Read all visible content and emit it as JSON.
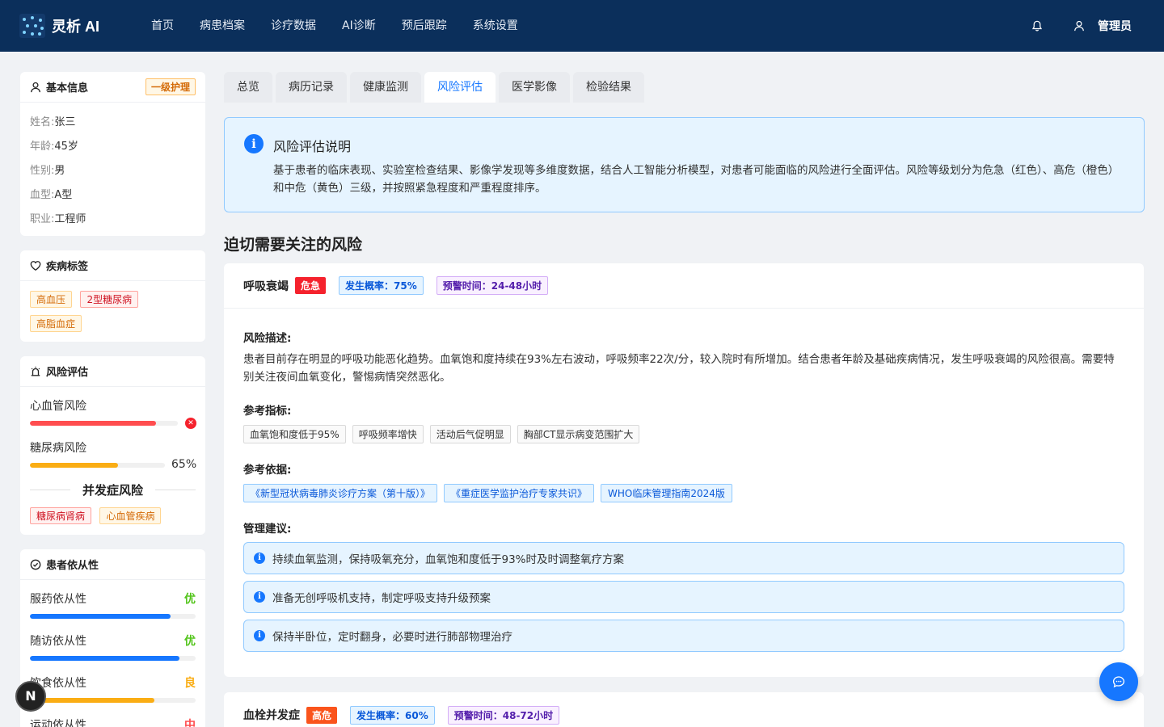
{
  "app": {
    "name": "灵析 AI"
  },
  "nav": [
    "首页",
    "病患档案",
    "诊疗数据",
    "AI诊断",
    "预后跟踪",
    "系统设置"
  ],
  "user": {
    "name": "管理员"
  },
  "basic": {
    "title": "基本信息",
    "badge": "一级护理",
    "rows": [
      {
        "k": "姓名:",
        "v": "张三"
      },
      {
        "k": "年龄:",
        "v": "45岁"
      },
      {
        "k": "性别:",
        "v": "男"
      },
      {
        "k": "血型:",
        "v": "A型"
      },
      {
        "k": "职业:",
        "v": "工程师"
      }
    ]
  },
  "disease": {
    "title": "疾病标签",
    "tags": [
      "高血压",
      "2型糖尿病",
      "高脂血症"
    ]
  },
  "risk_panel": {
    "title": "风险评估",
    "items": [
      {
        "label": "心血管风险",
        "percent": 85,
        "color": "#ff4d4f"
      },
      {
        "label": "糖尿病风险",
        "percent": 65,
        "pct_text": "65%",
        "color": "#faad14"
      }
    ],
    "complication_title": "并发症风险",
    "complications": [
      "糖尿病肾病",
      "心血管疾病"
    ]
  },
  "compliance": {
    "title": "患者依从性",
    "items": [
      {
        "label": "服药依从性",
        "grade": "优",
        "percent": 85,
        "color": "#1677ff",
        "grade_color": "#52c41a"
      },
      {
        "label": "随访依从性",
        "grade": "优",
        "percent": 90,
        "color": "#1677ff",
        "grade_color": "#52c41a"
      },
      {
        "label": "饮食依从性",
        "grade": "良",
        "percent": 75,
        "color": "#faad14",
        "grade_color": "#faad14"
      },
      {
        "label": "运动依从性",
        "grade": "中",
        "color": "#ff4d4f",
        "grade_color": "#ff4d4f"
      }
    ]
  },
  "tabs": [
    "总览",
    "病历记录",
    "健康监测",
    "风险评估",
    "医学影像",
    "检验结果"
  ],
  "active_tab": 3,
  "alert": {
    "title": "风险评估说明",
    "desc": "基于患者的临床表现、实验室检查结果、影像学发现等多维度数据，结合人工智能分析模型，对患者可能面临的风险进行全面评估。风险等级划分为危急（红色）、高危（橙色）和中危（黄色）三级，并按照紧急程度和严重程度排序。"
  },
  "section_title": "迫切需要关注的风险",
  "risk1": {
    "name": "呼吸衰竭",
    "level": "危急",
    "level_color": "#f5222d",
    "prob": "发生概率：75%",
    "warn": "预警时间：24-48小时",
    "desc_h": "风险描述:",
    "desc": "患者目前存在明显的呼吸功能恶化趋势。血氧饱和度持续在93%左右波动，呼吸频率22次/分，较入院时有所增加。结合患者年龄及基础疾病情况，发生呼吸衰竭的风险很高。需要特别关注夜间血氧变化，警惕病情突然恶化。",
    "ind_h": "参考指标:",
    "indicators": [
      "血氧饱和度低于95%",
      "呼吸频率增快",
      "活动后气促明显",
      "胸部CT显示病变范围扩大"
    ],
    "ref_h": "参考依据:",
    "refs": [
      "《新型冠状病毒肺炎诊疗方案（第十版）》",
      "《重症医学监护治疗专家共识》",
      "WHO临床管理指南2024版"
    ],
    "adv_h": "管理建议:",
    "advice": [
      "持续血氧监测，保持吸氧充分，血氧饱和度低于93%时及时调整氧疗方案",
      "准备无创呼吸机支持，制定呼吸支持升级预案",
      "保持半卧位，定时翻身，必要时进行肺部物理治疗"
    ]
  },
  "risk2": {
    "name": "血栓并发症",
    "level": "高危",
    "level_color": "#fa541c",
    "prob": "发生概率：60%",
    "warn": "预警时间：48-72小时"
  },
  "badge_letter": "N"
}
